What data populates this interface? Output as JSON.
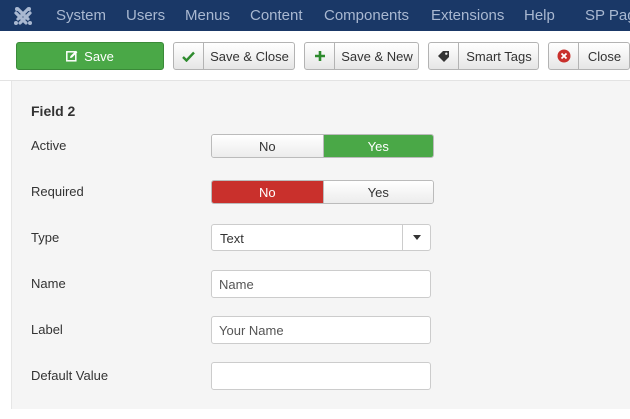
{
  "navbar": {
    "items": [
      "System",
      "Users",
      "Menus",
      "Content",
      "Components",
      "Extensions",
      "Help",
      "SP Pag"
    ]
  },
  "toolbar": {
    "save_label": "Save",
    "save_close_label": "Save & Close",
    "save_new_label": "Save & New",
    "smart_tags_label": "Smart Tags",
    "close_label": "Close"
  },
  "form": {
    "title": "Field 2",
    "active": {
      "label": "Active",
      "options": [
        "No",
        "Yes"
      ],
      "selected": "Yes"
    },
    "required": {
      "label": "Required",
      "options": [
        "No",
        "Yes"
      ],
      "selected": "No"
    },
    "type": {
      "label": "Type",
      "value": "Text"
    },
    "name": {
      "label": "Name",
      "placeholder": "Name"
    },
    "label_field": {
      "label": "Label",
      "placeholder": "Your Name"
    },
    "default_value": {
      "label": "Default Value",
      "value": ""
    }
  },
  "colors": {
    "navbar_bg": "#1a3867",
    "success": "#4aa847",
    "danger": "#c9302c"
  }
}
